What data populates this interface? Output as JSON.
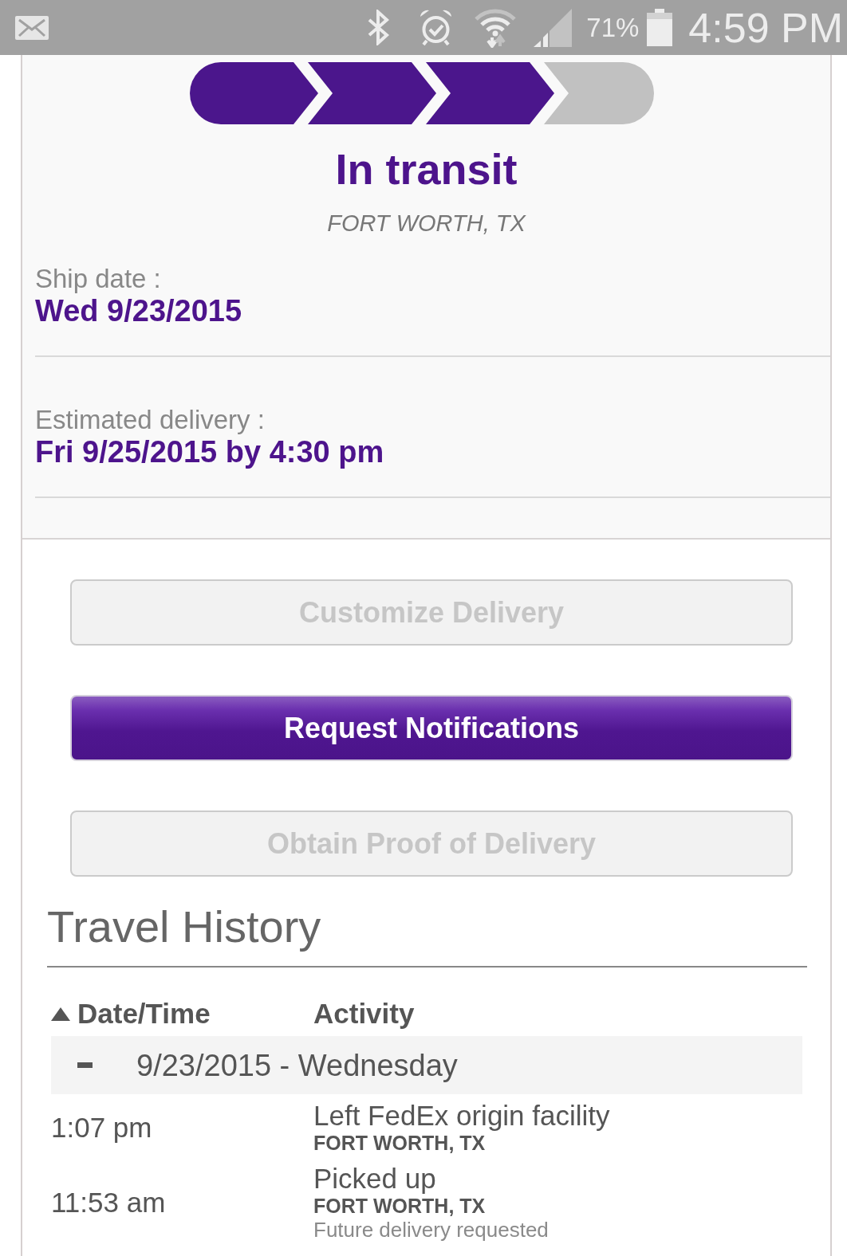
{
  "status_bar": {
    "battery_percent": "71%",
    "time": "4:59 PM"
  },
  "shipment": {
    "progress": [
      {
        "complete": true
      },
      {
        "complete": true
      },
      {
        "complete": true
      },
      {
        "complete": false
      }
    ],
    "status": "In transit",
    "location": "FORT WORTH, TX",
    "details": [
      {
        "label": "Ship date :",
        "value": "Wed 9/23/2015"
      },
      {
        "label": "Estimated delivery :",
        "value": "Fri 9/25/2015 by 4:30 pm"
      }
    ]
  },
  "actions": [
    {
      "label": "Customize Delivery",
      "disabled": true
    },
    {
      "label": "Request Notifications",
      "disabled": false
    },
    {
      "label": "Obtain Proof of Delivery",
      "disabled": true
    }
  ],
  "travel_history": {
    "title": "Travel History",
    "columns": [
      {
        "label": "Date/Time",
        "sorted": true
      },
      {
        "label": "Activity",
        "sorted": false
      }
    ],
    "groups": [
      {
        "date": "9/23/2015 - Wednesday",
        "expanded": true,
        "events": [
          {
            "time": "1:07 pm",
            "activity": "Left FedEx origin facility",
            "location": "FORT WORTH, TX"
          },
          {
            "time": "11:53 am",
            "activity": "Picked up",
            "location": "FORT WORTH, TX",
            "note": "Future delivery requested"
          }
        ]
      }
    ]
  }
}
